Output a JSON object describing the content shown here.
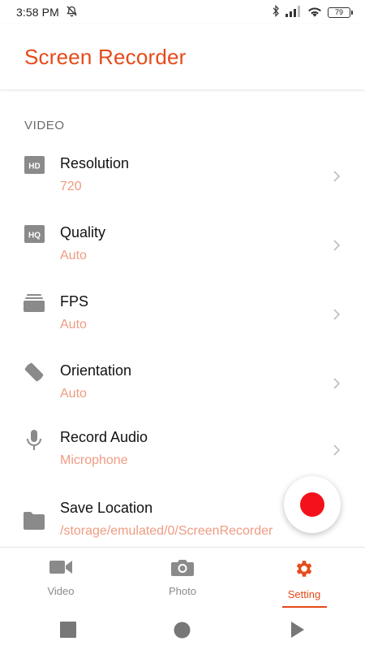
{
  "status_bar": {
    "time": "3:58 PM",
    "battery": "79",
    "icons": [
      "alarm-off-icon",
      "bluetooth-icon",
      "signal-icon",
      "wifi-icon",
      "battery-icon"
    ]
  },
  "app": {
    "title": "Screen Recorder",
    "accent_color": "#e64a19",
    "value_color": "#ee9b82"
  },
  "settings": {
    "section_header": "VIDEO",
    "items": [
      {
        "title": "Resolution",
        "value": "720",
        "icon": "hd-icon"
      },
      {
        "title": "Quality",
        "value": "Auto",
        "icon": "hq-icon"
      },
      {
        "title": "FPS",
        "value": "Auto",
        "icon": "layers-icon"
      },
      {
        "title": "Orientation",
        "value": "Auto",
        "icon": "screen-rotation-icon"
      },
      {
        "title": "Record Audio",
        "value": "Microphone",
        "icon": "microphone-icon"
      },
      {
        "title": "Save Location",
        "value": "/storage/emulated/0/ScreenRecorder",
        "icon": "folder-icon"
      }
    ]
  },
  "record_button": {
    "icon": "record-icon",
    "color": "#f3121b"
  },
  "bottom_nav": {
    "active": "Setting",
    "items": [
      {
        "label": "Video",
        "icon": "video-camera-icon"
      },
      {
        "label": "Photo",
        "icon": "camera-icon"
      },
      {
        "label": "Setting",
        "icon": "gear-icon"
      }
    ]
  },
  "system_nav": {
    "buttons": [
      "recents-square-icon",
      "home-circle-icon",
      "back-triangle-icon"
    ]
  }
}
